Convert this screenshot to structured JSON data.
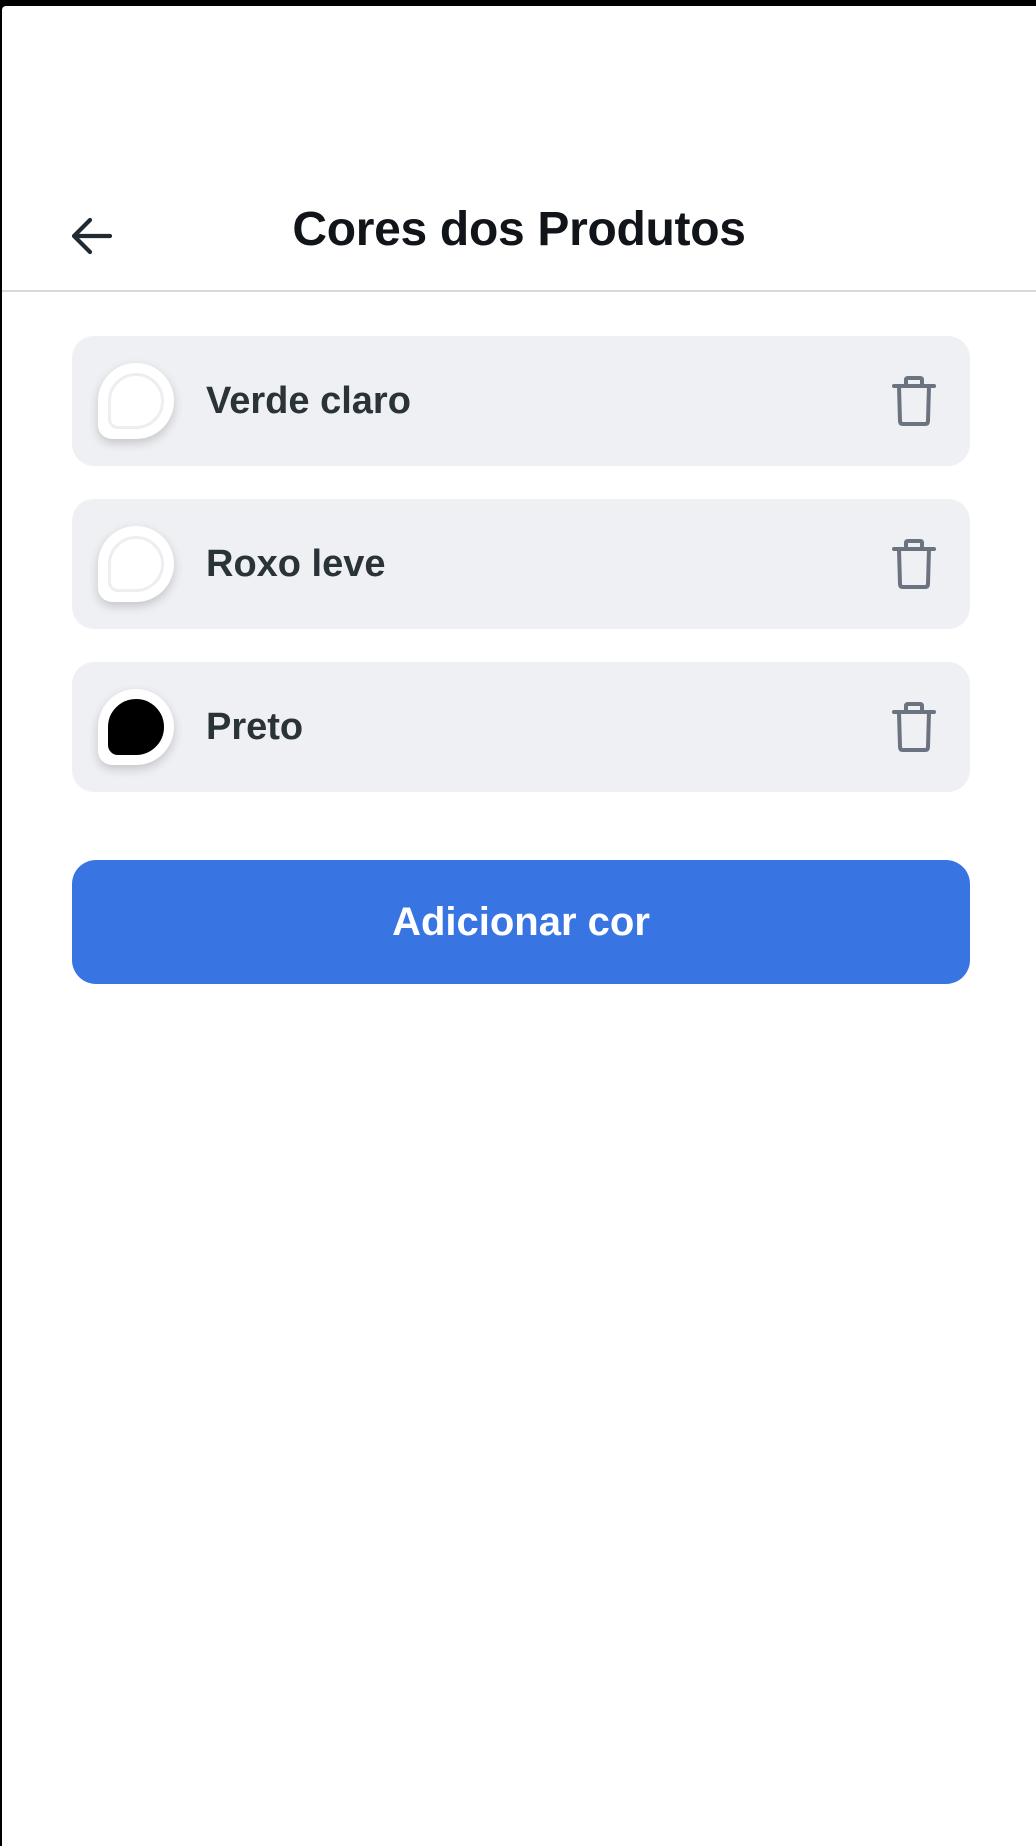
{
  "header": {
    "title": "Cores dos Produtos",
    "back_icon": "arrow-left-icon"
  },
  "colors": [
    {
      "name": "Verde claro",
      "swatch": "#ffffff",
      "delete_icon": "trash-icon"
    },
    {
      "name": "Roxo leve",
      "swatch": "#ffffff",
      "delete_icon": "trash-icon"
    },
    {
      "name": "Preto",
      "swatch": "#000000",
      "delete_icon": "trash-icon"
    }
  ],
  "add_button": {
    "label": "Adicionar cor"
  },
  "theme": {
    "primary": "#3875e3",
    "card_bg": "#eff0f3",
    "text": "#2a3338",
    "icon": "#6b7280"
  }
}
